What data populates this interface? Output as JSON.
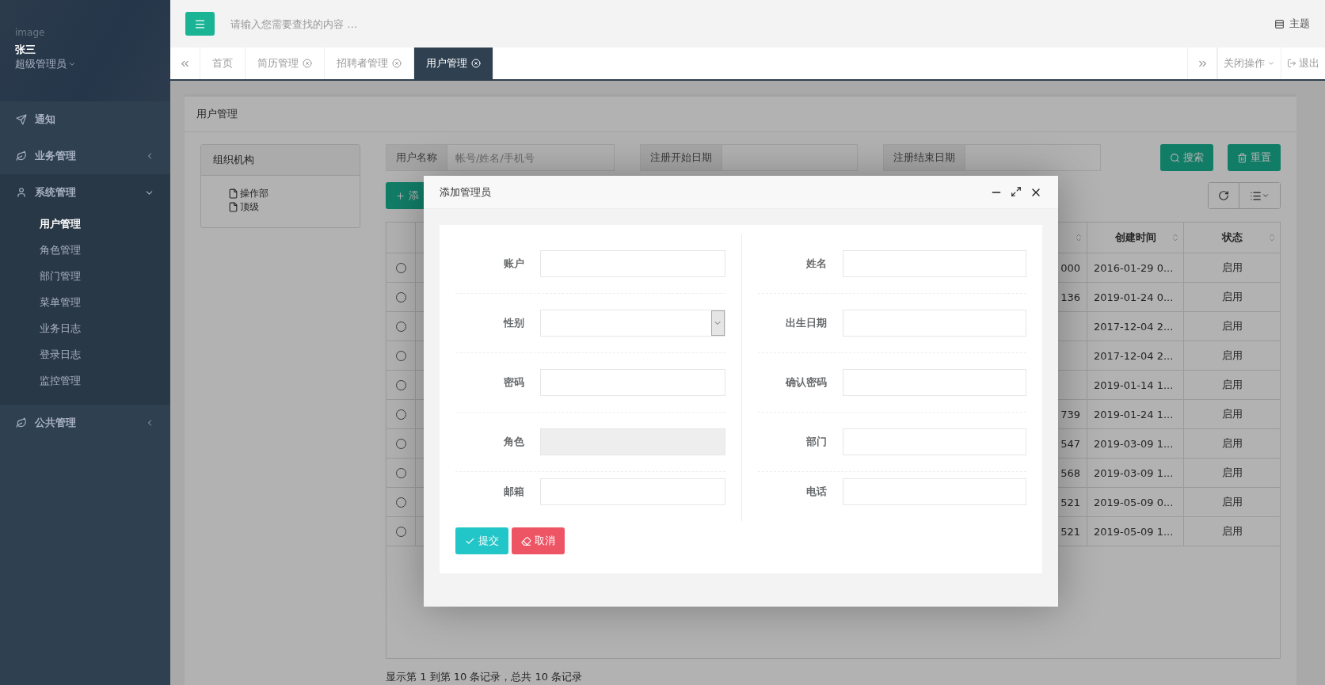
{
  "sidebar": {
    "avatar_caption": "image",
    "user_name": "张三",
    "role": "超级管理员",
    "menu": [
      {
        "label": "通知",
        "kind": "link"
      },
      {
        "label": "业务管理",
        "kind": "group",
        "expanded": false
      },
      {
        "label": "系统管理",
        "kind": "group",
        "expanded": true,
        "children": [
          {
            "label": "用户管理",
            "selected": true
          },
          {
            "label": "角色管理",
            "selected": false
          },
          {
            "label": "部门管理",
            "selected": false
          },
          {
            "label": "菜单管理",
            "selected": false
          },
          {
            "label": "业务日志",
            "selected": false
          },
          {
            "label": "登录日志",
            "selected": false
          },
          {
            "label": "监控管理",
            "selected": false
          }
        ]
      },
      {
        "label": "公共管理",
        "kind": "group",
        "expanded": false
      }
    ]
  },
  "topbar": {
    "search_placeholder": "请输入您需要查找的内容 …",
    "theme": "主题"
  },
  "tabs": [
    {
      "label": "首页",
      "closable": false,
      "selected": false
    },
    {
      "label": "简历管理",
      "closable": true,
      "selected": false
    },
    {
      "label": "招聘者管理",
      "closable": true,
      "selected": false
    },
    {
      "label": "用户管理",
      "closable": true,
      "selected": true
    }
  ],
  "tab_actions": {
    "close_menu": "关闭操作",
    "logout": "退出"
  },
  "panel": {
    "title": "用户管理",
    "org": {
      "title": "组织机构",
      "tree": [
        {
          "label": "操作部"
        },
        {
          "label": "顶级"
        }
      ]
    },
    "search": [
      {
        "label": "用户名称",
        "placeholder": "帐号/姓名/手机号"
      },
      {
        "label": "注册开始日期"
      },
      {
        "label": "注册结束日期"
      }
    ],
    "search_buttons": [
      "搜索",
      "重置"
    ],
    "add_button": "添",
    "table": {
      "columns": [
        "创建时间",
        "状态"
      ],
      "rows": [
        {
          "selected": false,
          "column_3": "000",
          "created": "2016-01-29 0...",
          "status": "启用"
        },
        {
          "selected": false,
          "column_3": "136",
          "created": "2019-01-24 0...",
          "status": "启用"
        },
        {
          "selected": false,
          "column_3": "",
          "created": "2017-12-04 2...",
          "status": "启用"
        },
        {
          "selected": false,
          "column_3": "",
          "created": "2017-12-04 2...",
          "status": "启用"
        },
        {
          "selected": false,
          "column_3": "",
          "created": "2019-01-14 1...",
          "status": "启用"
        },
        {
          "selected": false,
          "column_3": "739",
          "created": "2019-01-24 1...",
          "status": "启用"
        },
        {
          "selected": false,
          "column_3": "547",
          "created": "2019-03-09 1...",
          "status": "启用"
        },
        {
          "selected": false,
          "column_3": "568",
          "created": "2019-03-09 1...",
          "status": "启用"
        },
        {
          "selected": false,
          "column_3": "521",
          "created": "2019-05-09 0...",
          "status": "启用"
        },
        {
          "selected": false,
          "column_3": "521",
          "created": "2019-05-09 1...",
          "status": "启用"
        }
      ]
    },
    "footer": "显示第 1 到第 10 条记录，总共 10 条记录"
  },
  "modal": {
    "title": "添加管理员",
    "left_fields": [
      {
        "label": "账户",
        "kind": "text"
      },
      {
        "label": "性别",
        "kind": "select"
      },
      {
        "label": "密码",
        "kind": "text"
      },
      {
        "label": "角色",
        "kind": "disabled"
      },
      {
        "label": "邮箱",
        "kind": "text"
      }
    ],
    "right_fields": [
      {
        "label": "姓名",
        "kind": "text"
      },
      {
        "label": "出生日期",
        "kind": "text"
      },
      {
        "label": "确认密码",
        "kind": "text"
      },
      {
        "label": "部门",
        "kind": "text"
      },
      {
        "label": "电话",
        "kind": "text"
      }
    ],
    "submit": "提交",
    "cancel": "取消"
  }
}
